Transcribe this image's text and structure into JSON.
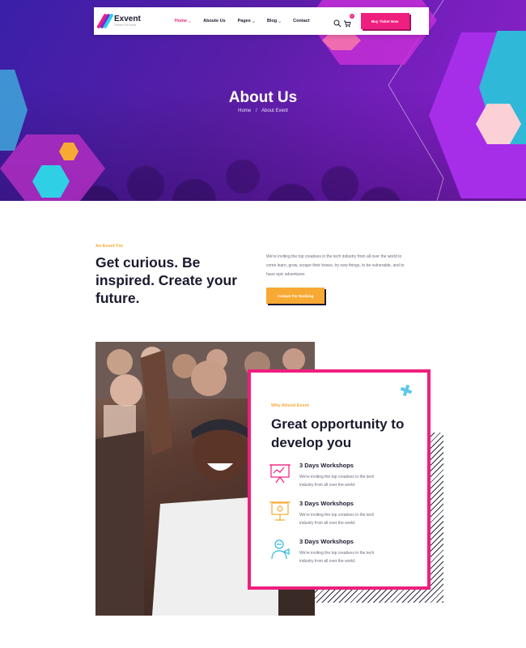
{
  "colors": {
    "primary": "#ee1f7e",
    "accent": "#f7a934",
    "dark": "#1a1a2e",
    "cyan": "#2fd0e5"
  },
  "header": {
    "brand": "Exvent",
    "tagline": "Theme For Event",
    "menu": [
      {
        "label": "Home",
        "active": true,
        "has_dropdown": true
      },
      {
        "label": "Aboute Us",
        "active": false,
        "has_dropdown": false
      },
      {
        "label": "Pages",
        "active": false,
        "has_dropdown": true
      },
      {
        "label": "Blog",
        "active": false,
        "has_dropdown": true
      },
      {
        "label": "Contact",
        "active": false,
        "has_dropdown": false
      }
    ],
    "cart_count": "0",
    "ticket_button": "Buy Ticket Now",
    "icons": [
      "search-icon",
      "cart-icon"
    ]
  },
  "hero": {
    "title": "About Us",
    "breadcrumb": {
      "home": "Home",
      "separator": "/",
      "current": "About Event"
    }
  },
  "intro": {
    "eyebrow": "An Event For",
    "title": "Get curious. Be inspired. Create your future.",
    "text": "We're inviting the top creatives in the tech industry from all over the world to come learn, grow, scrape their knees, try new things, to be vulnerable, and to have epic adventures",
    "button": "Contact For Booking"
  },
  "attend": {
    "eyebrow": "Why Attend Event",
    "title": "Great opportunity to develop you",
    "features": [
      {
        "title": "3 Days Workshops",
        "desc": "We're inviting the top creatives in the tech industry from all over the world.",
        "icon": "presentation-board-icon"
      },
      {
        "title": "3 Days Workshops",
        "desc": "We're inviting the top creatives in the tech industry from all over the world.",
        "icon": "projector-screen-icon"
      },
      {
        "title": "3 Days Workshops",
        "desc": "We're inviting the top creatives in the tech industry from all over the world.",
        "icon": "speaker-person-icon"
      }
    ]
  }
}
